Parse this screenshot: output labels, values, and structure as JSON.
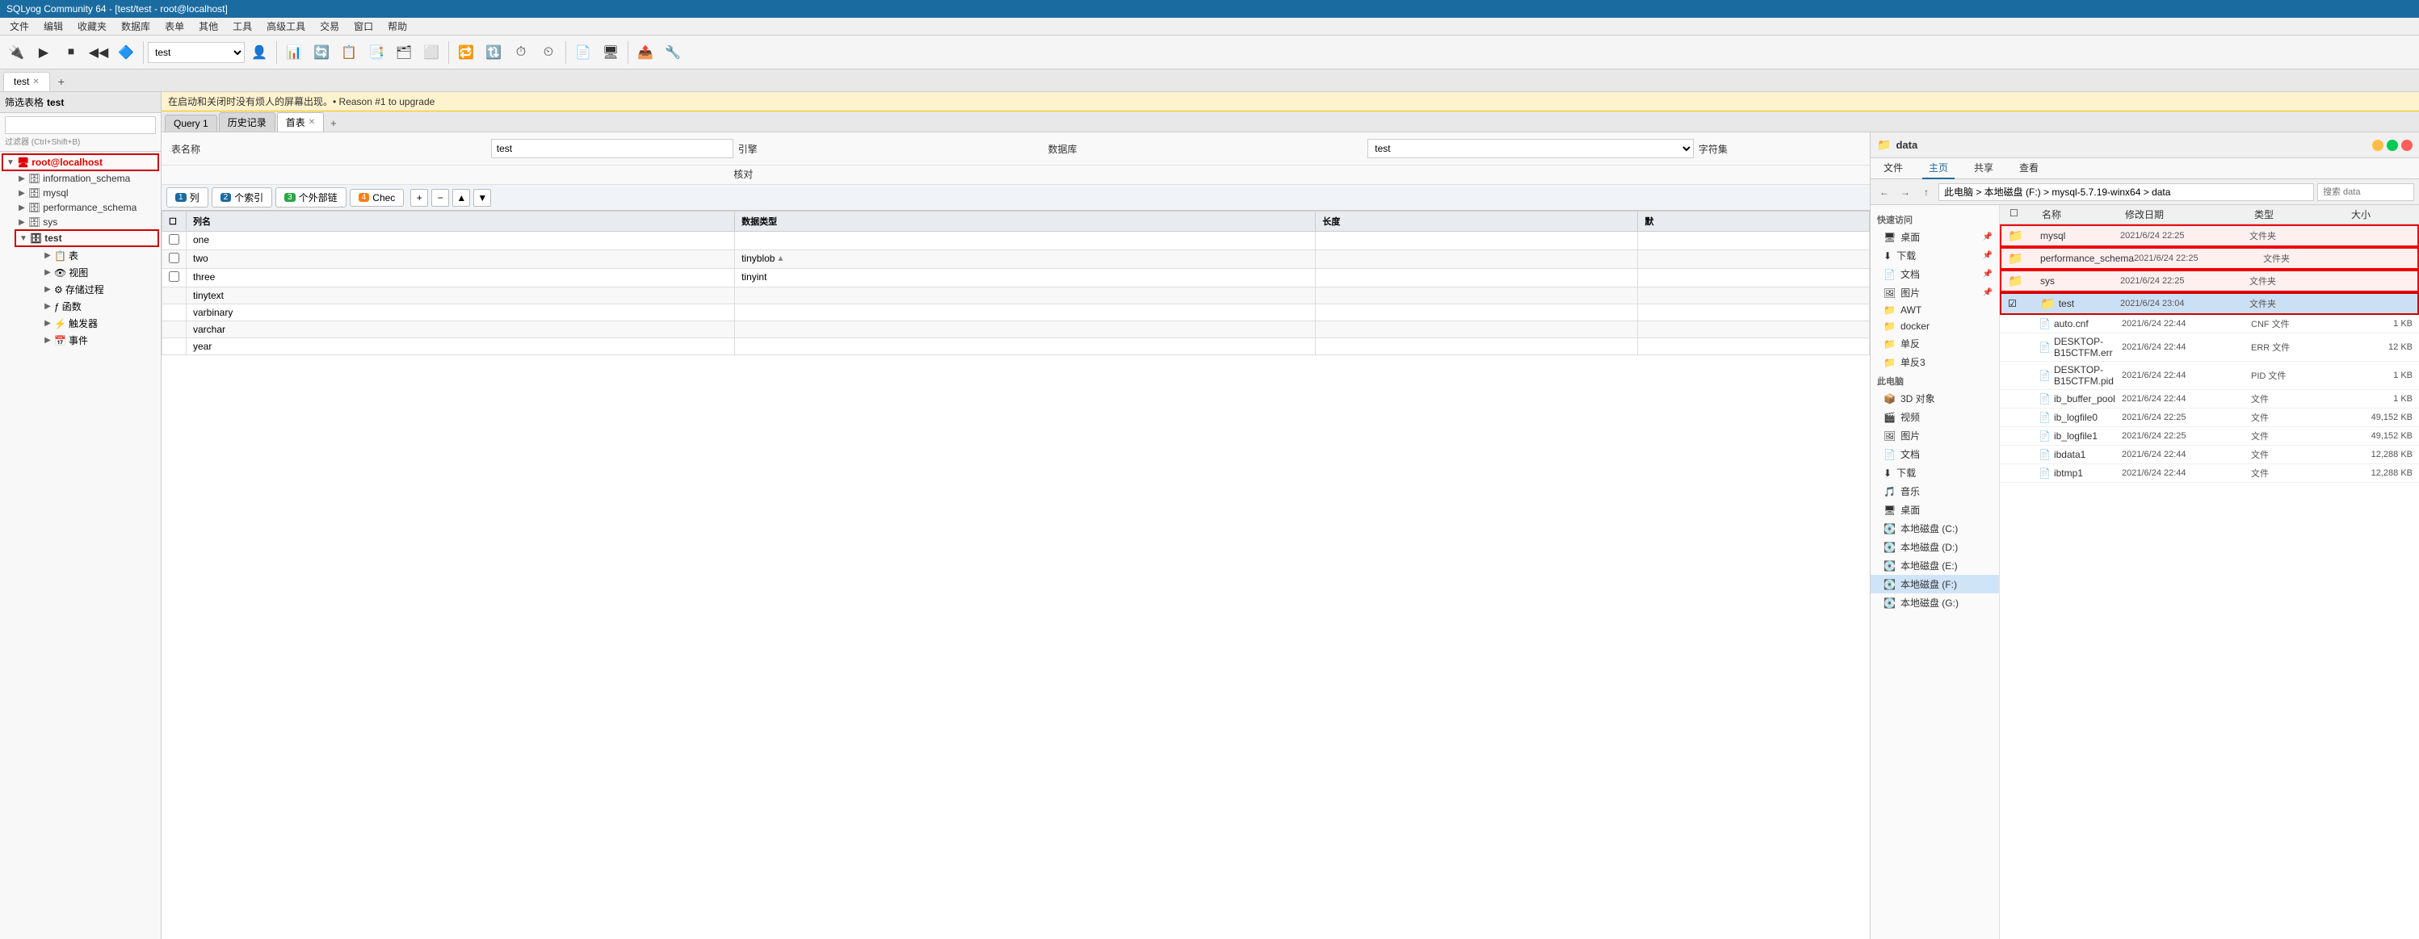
{
  "titleBar": {
    "text": "SQLyog Community 64 - [test/test - root@localhost]"
  },
  "menuBar": {
    "items": [
      "文件",
      "编辑",
      "收藏夹",
      "数据库",
      "表单",
      "其他",
      "工具",
      "高级工具",
      "交易",
      "窗口",
      "帮助"
    ]
  },
  "toolbar": {
    "dbSelect": "test",
    "newBtn": "新建",
    "openBtn": "打开"
  },
  "mainTab": {
    "tabs": [
      {
        "id": "t1",
        "label": "test",
        "closable": true,
        "active": true
      },
      {
        "id": "t2",
        "label": "+",
        "closable": false,
        "active": false
      }
    ]
  },
  "sidebar": {
    "header": "筛选表格 test",
    "filter": {
      "placeholder": "",
      "hint": "过滤器 (Ctrl+Shift+B)"
    },
    "tree": {
      "root": "root@localhost",
      "databases": [
        {
          "name": "information_schema",
          "active": false
        },
        {
          "name": "mysql",
          "active": false
        },
        {
          "name": "performance_schema",
          "active": false
        },
        {
          "name": "sys",
          "active": false
        },
        {
          "name": "test",
          "active": true
        }
      ],
      "testSubItems": [
        "表",
        "视图",
        "存储过程",
        "函数",
        "触发器",
        "事件"
      ]
    }
  },
  "noticeBar": {
    "text": "在启动和关闭时没有烦人的屏幕出现。• Reason #1 to upgrade"
  },
  "editorTabs": {
    "tabs": [
      {
        "id": "q1",
        "label": "Query 1",
        "active": false
      },
      {
        "id": "h1",
        "label": "历史记录",
        "active": false
      },
      {
        "id": "t1",
        "label": "首表",
        "active": true,
        "closable": true
      }
    ]
  },
  "tableForm": {
    "nameLabel": "表名称",
    "nameValue": "test",
    "engineLabel": "引擎",
    "engineValue": "",
    "dbLabel": "数据库",
    "dbValue": "test",
    "charsetLabel": "字符集",
    "charsetValue": "",
    "collateLabel": "核对",
    "collateValue": ""
  },
  "columnTabs": {
    "tab1": {
      "label": "1列",
      "badge": "1",
      "badgeColor": "blue"
    },
    "tab2": {
      "label": "2个索引",
      "badge": "2",
      "badgeColor": "blue"
    },
    "tab3": {
      "label": "3个外部链",
      "badge": "3",
      "badgeColor": "green"
    },
    "tab4": {
      "label": "4 Chec",
      "badge": "4",
      "badgeColor": "orange"
    },
    "actions": [
      "+",
      "-",
      "↑",
      "↓"
    ]
  },
  "columnsTable": {
    "headers": [
      "☐",
      "列名",
      "数据类型",
      "长度",
      "默认"
    ],
    "rows": [
      {
        "checkbox": false,
        "name": "one",
        "type": "",
        "length": "",
        "default": ""
      },
      {
        "checkbox": false,
        "name": "two",
        "type": "tinyblob",
        "length": "",
        "default": ""
      },
      {
        "checkbox": false,
        "name": "three",
        "type": "tinyint",
        "length": "",
        "default": ""
      },
      {
        "extra_types": [
          "tinytext",
          "varbinary",
          "varchar",
          "year"
        ]
      }
    ]
  },
  "typeDropdown": {
    "options": [
      "tinyblob",
      "tinyint",
      "tinytext",
      "varbinary",
      "varchar",
      "year"
    ]
  },
  "fileExplorer": {
    "title": "data",
    "titleIcon": "📁",
    "ribbonTabs": [
      "文件",
      "主页",
      "共享",
      "查看"
    ],
    "addressPath": "此电脑 > 本地磁盘 (F:) > mysql-5.7.19-winx64 > data",
    "searchPlaceholder": "搜索 data",
    "sidebarQuickAccess": "快速访问",
    "sidebarItems": [
      {
        "name": "桌面",
        "pinned": true
      },
      {
        "name": "下载",
        "pinned": true
      },
      {
        "name": "文档",
        "pinned": true
      },
      {
        "name": "图片",
        "pinned": true
      },
      {
        "name": "AWT"
      },
      {
        "name": "docker"
      },
      {
        "name": "单反"
      },
      {
        "name": "单反3"
      }
    ],
    "sidebarComputerItems": [
      {
        "name": "此电脑"
      },
      {
        "name": "3D 对象"
      },
      {
        "name": "视频"
      },
      {
        "name": "图片"
      },
      {
        "name": "文档"
      },
      {
        "name": "下载"
      },
      {
        "name": "音乐"
      },
      {
        "name": "桌面"
      },
      {
        "name": "本地磁盘 (C:)"
      },
      {
        "name": "本地磁盘 (D:)"
      },
      {
        "name": "本地磁盘 (E:)"
      },
      {
        "name": "本地磁盘 (F:)",
        "selected": true
      },
      {
        "name": "本地磁盘 (G:)"
      }
    ],
    "columns": [
      "名称",
      "修改日期",
      "类型",
      "大小"
    ],
    "files": [
      {
        "type": "folder",
        "name": "mysql",
        "date": "2021/6/24 22:25",
        "kind": "文件夹",
        "size": "",
        "highlighted": true
      },
      {
        "type": "folder",
        "name": "performance_schema",
        "date": "2021/6/24 22:25",
        "kind": "文件夹",
        "size": "",
        "highlighted": true
      },
      {
        "type": "folder",
        "name": "sys",
        "date": "2021/6/24 22:25",
        "kind": "文件夹",
        "size": "",
        "highlighted": true
      },
      {
        "type": "folder",
        "name": "test",
        "date": "2021/6/24 23:04",
        "kind": "文件夹",
        "size": "",
        "highlighted": true,
        "selected": true
      },
      {
        "type": "file",
        "name": "auto.cnf",
        "date": "2021/6/24 22:44",
        "kind": "CNF 文件",
        "size": "1 KB"
      },
      {
        "type": "file",
        "name": "DESKTOP-B15CTFM.err",
        "date": "2021/6/24 22:44",
        "kind": "ERR 文件",
        "size": "12 KB"
      },
      {
        "type": "file",
        "name": "DESKTOP-B15CTFM.pid",
        "date": "2021/6/24 22:44",
        "kind": "PID 文件",
        "size": "1 KB"
      },
      {
        "type": "file",
        "name": "ib_buffer_pool",
        "date": "2021/6/24 22:44",
        "kind": "文件",
        "size": "1 KB"
      },
      {
        "type": "file",
        "name": "ib_logfile0",
        "date": "2021/6/24 22:25",
        "kind": "文件",
        "size": "49,152 KB"
      },
      {
        "type": "file",
        "name": "ib_logfile1",
        "date": "2021/6/24 22:25",
        "kind": "文件",
        "size": "49,152 KB"
      },
      {
        "type": "file",
        "name": "ibdata1",
        "date": "2021/6/24 22:44",
        "kind": "文件",
        "size": "12,288 KB"
      },
      {
        "type": "file",
        "name": "ibtmp1",
        "date": "2021/6/24 22:44",
        "kind": "文件",
        "size": "12,288 KB"
      }
    ]
  }
}
